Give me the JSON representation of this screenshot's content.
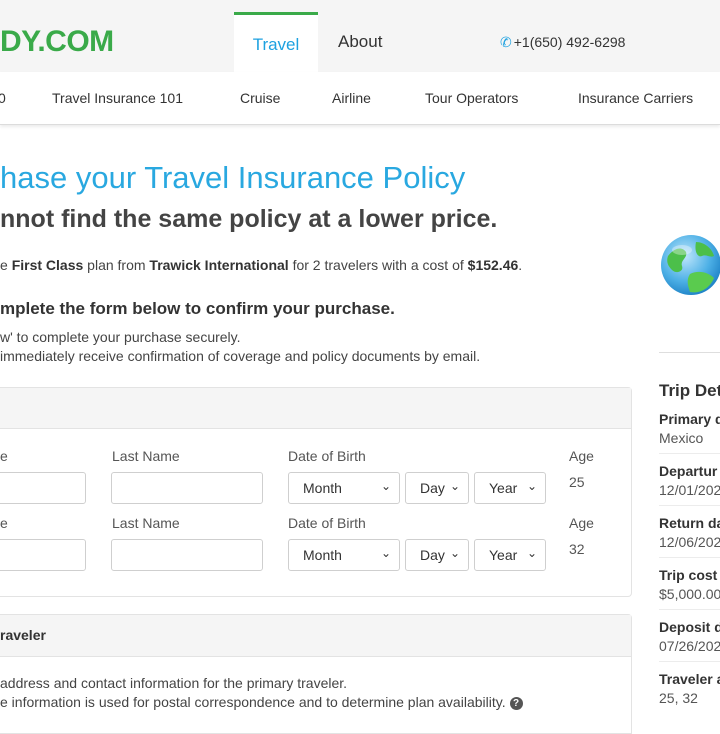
{
  "header": {
    "logo_text": "DY.COM",
    "tabs": [
      {
        "label": "Travel",
        "active": true
      },
      {
        "label": "About",
        "active": false
      }
    ],
    "phone": "+1(650) 492-6298",
    "accent_color": "#3aaa49",
    "link_color": "#1da1e0"
  },
  "subnav": {
    "items": [
      "0",
      "Travel Insurance 101",
      "Cruise",
      "Airline",
      "Tour Operators",
      "Insurance Carriers"
    ]
  },
  "main": {
    "title": "hase your Travel Insurance Policy",
    "subtitle": "nnot find the same policy at a lower price.",
    "summary": {
      "pre": "e ",
      "plan": "First Class",
      "mid1": " plan from ",
      "carrier": "Trawick International",
      "mid2": " for 2 travelers with a cost of ",
      "price": "$152.46",
      "post": "."
    },
    "instructions_heading": "mplete the form below to confirm your purchase.",
    "instruction_line1": "w' to complete your purchase securely.",
    "instruction_line2": " immediately receive confirmation of coverage and policy documents by email."
  },
  "traveler_form": {
    "rows": [
      {
        "first_label": "e",
        "last_label": "Last Name",
        "dob_label": "Date of Birth",
        "month": "Month",
        "day": "Day",
        "year": "Year",
        "age_label": "Age",
        "age": "25"
      },
      {
        "first_label": "e",
        "last_label": "Last Name",
        "dob_label": "Date of Birth",
        "month": "Month",
        "day": "Day",
        "year": "Year",
        "age_label": "Age",
        "age": "32"
      }
    ]
  },
  "primary_traveler": {
    "heading": "raveler",
    "line1": "address and contact information for the primary traveler.",
    "line2": "e information is used for postal correspondence and to determine plan availability.",
    "help_icon": "?"
  },
  "sidebar": {
    "title": "Trip Det",
    "fields": [
      {
        "label": "Primary d",
        "value": "Mexico"
      },
      {
        "label": "Departur",
        "value": "12/01/202"
      },
      {
        "label": "Return da",
        "value": "12/06/202"
      },
      {
        "label": "Trip cost",
        "value": "$5,000.00"
      },
      {
        "label": "Deposit d",
        "value": "07/26/202"
      },
      {
        "label": "Traveler a",
        "value": "25, 32"
      }
    ]
  }
}
